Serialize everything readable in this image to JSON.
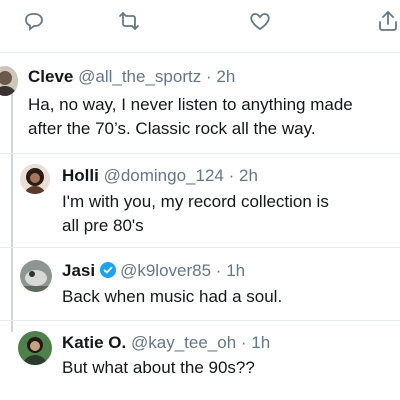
{
  "actions": {
    "reply_icon": "reply-icon",
    "retweet_icon": "retweet-icon",
    "like_icon": "heart-icon",
    "share_icon": "share-icon"
  },
  "colors": {
    "verified": "#1da1f2",
    "meta": "#657786",
    "text": "#14171a",
    "divider": "#e6ecf0"
  },
  "replies": [
    {
      "name": "Cleve",
      "handle": "@all_the_sportz",
      "sep": "·",
      "time": "2h",
      "text_lines": [
        "Ha, no way, I never listen to anything made",
        "after the 70’s. Classic rock all the way."
      ],
      "verified": false
    },
    {
      "name": "Holli",
      "handle": "@domingo_124",
      "sep": "·",
      "time": "2h",
      "text_lines": [
        "I'm with you, my record collection is",
        "all pre 80's"
      ],
      "verified": false
    },
    {
      "name": "Jasi",
      "handle": "@k9lover85",
      "sep": "·",
      "time": "1h",
      "text_lines": [
        "Back when music had a soul."
      ],
      "verified": true
    },
    {
      "name": "Katie O.",
      "handle": "@kay_tee_oh",
      "sep": "·",
      "time": "1h",
      "text_lines": [
        "But what about the 90s??"
      ],
      "verified": false
    }
  ]
}
